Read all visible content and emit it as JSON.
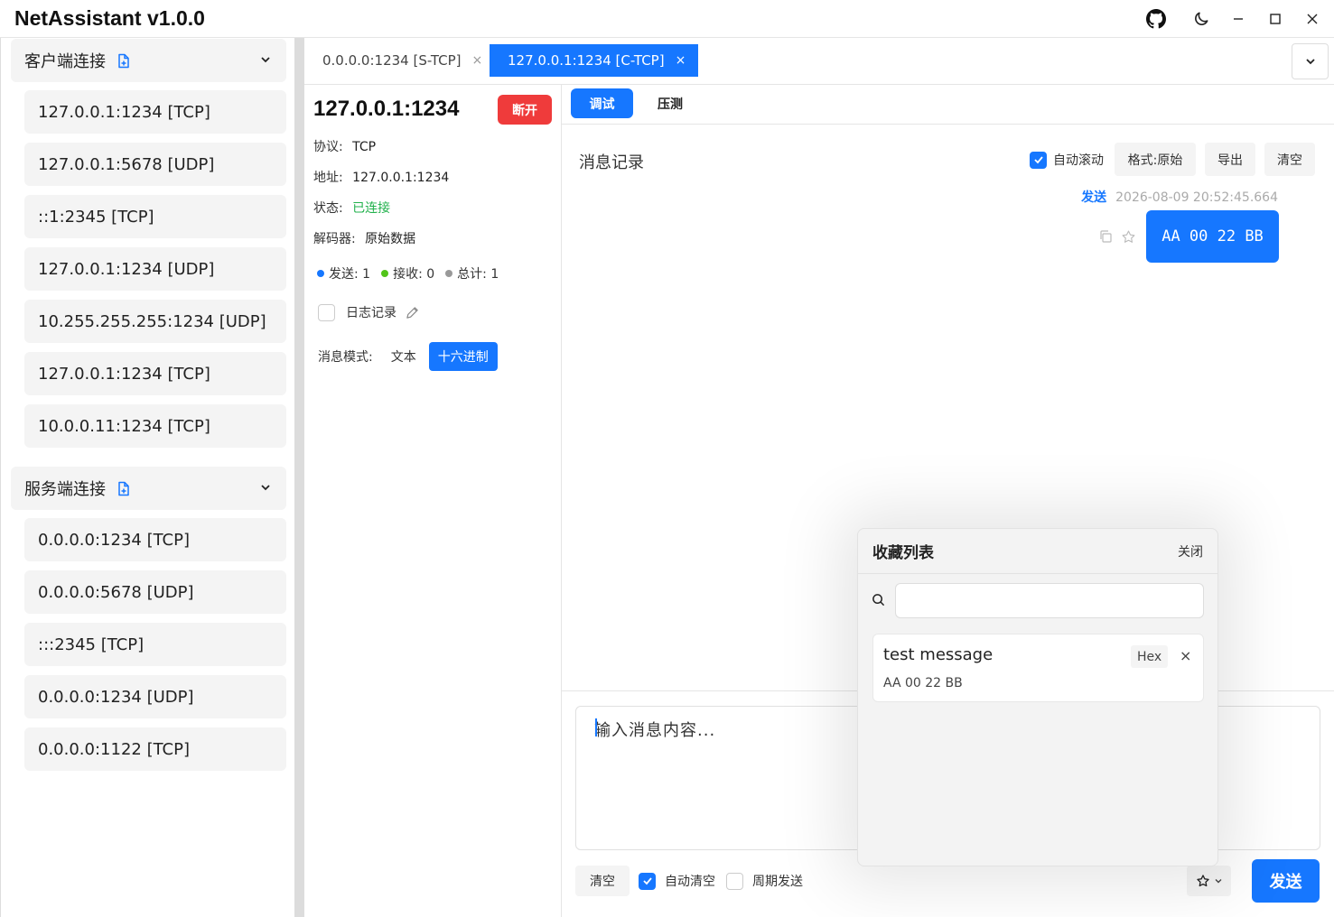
{
  "app": {
    "title": "NetAssistant v1.0.0",
    "controls": [
      "github-icon",
      "moon-icon",
      "minimize-icon",
      "maximize-icon",
      "close-icon"
    ]
  },
  "sidebar": {
    "client_group": {
      "title": "客户端连接",
      "items": [
        "127.0.0.1:1234 [TCP]",
        "127.0.0.1:5678 [UDP]",
        "::1:2345 [TCP]",
        "127.0.0.1:1234 [UDP]",
        "10.255.255.255:1234 [UDP]",
        "127.0.0.1:1234 [TCP]",
        "10.0.0.11:1234 [TCP]"
      ]
    },
    "server_group": {
      "title": "服务端连接",
      "items": [
        "0.0.0.0:1234 [TCP]",
        "0.0.0.0:5678 [UDP]",
        ":::2345 [TCP]",
        "0.0.0.0:1234 [UDP]",
        "0.0.0.0:1122 [TCP]"
      ]
    }
  },
  "tabs": [
    {
      "label": "0.0.0.0:1234 [S-TCP]",
      "active": false
    },
    {
      "label": "127.0.0.1:1234 [C-TCP]",
      "active": true
    }
  ],
  "tab_close_glyph": "×",
  "info": {
    "address": "127.0.0.1:1234",
    "disconnect_label": "断开",
    "protocol_key": "协议:",
    "protocol_val": "TCP",
    "addr_key": "地址:",
    "addr_val": "127.0.0.1:1234",
    "status_key": "状态:",
    "status_val": "已连接",
    "decoder_key": "解码器:",
    "decoder_val": "原始数据",
    "stats": {
      "sent": "发送: 1",
      "recv": "接收: 0",
      "total": "总计: 1"
    },
    "log_label": "日志记录",
    "mode_label": "消息模式:",
    "mode_text": "文本",
    "mode_hex": "十六进制"
  },
  "colors": {
    "accent": "#1677ff",
    "danger": "#ef3b3b",
    "success": "#22b14c",
    "sent_dot": "#1677ff",
    "recv_dot": "#52c41a",
    "total_dot": "#999999"
  },
  "subtabs": {
    "debug": "调试",
    "stress": "压测"
  },
  "messages": {
    "title": "消息记录",
    "autoscroll_label": "自动滚动",
    "format_label": "格式:原始",
    "export_label": "导出",
    "clear_label": "清空",
    "items": [
      {
        "direction": "发送",
        "timestamp": "2026-08-09 20:52:45.664",
        "content": "AA 00 22 BB"
      }
    ]
  },
  "composer": {
    "placeholder": "输入消息内容...",
    "clear_label": "清空",
    "auto_clear_label": "自动清空",
    "periodic_label": "周期发送",
    "send_label": "发送"
  },
  "favorites": {
    "title": "收藏列表",
    "close_label": "关闭",
    "search_value": "",
    "items": [
      {
        "name": "test message",
        "tag": "Hex",
        "data": "AA 00 22 BB"
      }
    ],
    "delete_glyph": "×"
  }
}
